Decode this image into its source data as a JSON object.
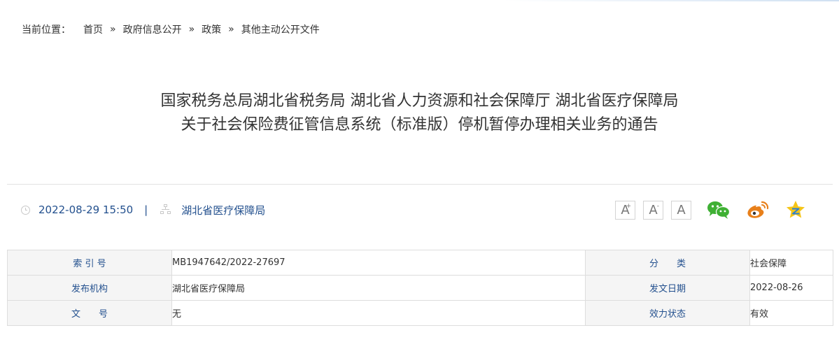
{
  "breadcrumb": {
    "lead": "当前位置：",
    "items": [
      "首页",
      "政府信息公开",
      "政策",
      "其他主动公开文件"
    ],
    "separator": "»"
  },
  "article": {
    "title_line1": "国家税务总局湖北省税务局 湖北省人力资源和社会保障厅 湖北省医疗保障局",
    "title_line2": "关于社会保险费征管信息系统（标准版）停机暂停办理相关业务的通告"
  },
  "meta": {
    "datetime": "2022-08-29 15:50",
    "pipe": "|",
    "source": "湖北省医疗保障局",
    "font_increase_label": "A",
    "font_decrease_label": "A",
    "font_reset_label": "A",
    "font_plus_mark": "+",
    "font_minus_mark": "-"
  },
  "info_table": {
    "row1": {
      "label_a": "索 引 号",
      "value_a": "MB1947642/2022-27697",
      "label_b": "分　　类",
      "value_b": "社会保障"
    },
    "row2": {
      "label_a": "发布机构",
      "value_a": "湖北省医疗保障局",
      "label_b": "发文日期",
      "value_b": "2022-08-26"
    },
    "row3": {
      "label_a": "文　　号",
      "value_a": "无",
      "label_b": "效力状态",
      "value_b": "有效"
    }
  },
  "colors": {
    "link_blue": "#23508e",
    "wechat_green": "#3fb034",
    "weibo_orange": "#e8801b",
    "qzone_yellow": "#f5c518"
  }
}
